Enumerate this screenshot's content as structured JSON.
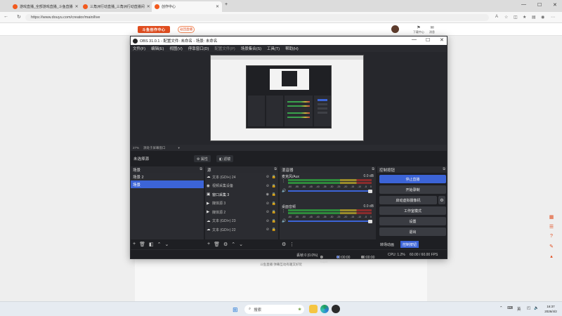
{
  "browser": {
    "tabs": [
      {
        "label": "游戏直播_全部游戏直播_斗鱼直播"
      },
      {
        "label": "三角洲行动直播_三角洲行动直播间"
      },
      {
        "label": "创作中心"
      }
    ],
    "new_tab": "+",
    "url": "https://www.douyu.com/creator/main/live",
    "win_min": "—",
    "win_max": "☐",
    "win_close": "✕"
  },
  "site": {
    "logo_text": "斗鱼创作中心",
    "header_button": "返回直播",
    "header_items": [
      {
        "icon": "⚑",
        "label": "下载中心"
      },
      {
        "icon": "✉",
        "label": "消息"
      }
    ],
    "footer_text": "斗鱼直播  弹幕互动有趣又好玩"
  },
  "obs": {
    "title": "OBS 31.0.1 - 配置文件: 未命名 - 场景: 未命名",
    "menu": [
      "文件(F)",
      "编辑(E)",
      "视图(V)",
      "停靠窗口(D)",
      "配置文件(P)",
      "场景集合(S)",
      "工具(T)",
      "帮助(H)"
    ],
    "zoom": "27%",
    "zoom_label": "源处于屏幕窗口",
    "no_source": "未选择源",
    "props_button": "⚙ 属性",
    "filters_button": "◧ 滤镜",
    "scenes": {
      "title": "场景",
      "items": [
        {
          "label": "场景 2",
          "selected": false
        },
        {
          "label": "场景",
          "selected": true
        }
      ]
    },
    "sources": {
      "title": "源",
      "items": [
        {
          "icon": "☁",
          "label": "文本 (GDI+) 24"
        },
        {
          "icon": "◉",
          "label": "视频采集设备"
        },
        {
          "icon": "▣",
          "label": "窗口采集 3"
        },
        {
          "icon": "▶",
          "label": "媒体源 3"
        },
        {
          "icon": "▶",
          "label": "媒体源 2"
        },
        {
          "icon": "☁",
          "label": "文本 (GDI+) 23"
        },
        {
          "icon": "☁",
          "label": "文本 (GDI+) 22"
        }
      ]
    },
    "mixer": {
      "title": "混音器",
      "tracks": [
        {
          "name": "麦克风/Aux",
          "db": "0.0 dB"
        },
        {
          "name": "桌面音频",
          "db": "0.0 dB"
        }
      ],
      "scale": [
        "-60",
        "-55",
        "-50",
        "-45",
        "-40",
        "-35",
        "-30",
        "-25",
        "-20",
        "-15",
        "-10",
        "-5",
        "0"
      ]
    },
    "controls": {
      "title": "控制按钮",
      "buttons": [
        "停止直播",
        "开始录制",
        "启动虚拟摄像机",
        "工作室模式",
        "设置",
        "退出"
      ],
      "tabs": [
        "转场动画",
        "控制按钮"
      ]
    },
    "status": {
      "dropped": "丢帧 0 (0.0%)",
      "kbps": "0 kbps",
      "live_time": "00:00:00",
      "rec_time": "00:00:00",
      "cpu": "CPU: 1.2%",
      "fps": "60.00 / 60.00 FPS"
    }
  },
  "taskbar": {
    "search_placeholder": "搜索",
    "lang": "英",
    "time": "16:37",
    "date": "2026/4/2"
  },
  "colors": {
    "obs_blue": "#3c64d7",
    "obs_bg": "#1e1f23",
    "douyu_orange": "#e04d1f"
  }
}
